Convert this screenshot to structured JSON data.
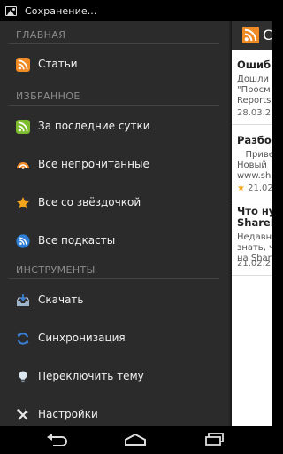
{
  "status_bar": {
    "icon": "image-icon",
    "text": "Сохранение..."
  },
  "action_bar": {
    "app_icon": "rss-app-icon",
    "title": "С"
  },
  "feed_items": [
    {
      "title": "Ошибк",
      "snippet": "Дошли\n\"Просм\nReports",
      "date": "28.03.2",
      "starred": false
    },
    {
      "title": "Разбор",
      "snippet": "   Приве\nНовый\nwww.sh",
      "date": "21.02",
      "starred": true
    },
    {
      "title": "Что ну\nShareP",
      "snippet": "Недавн\nзнать, ч\nна Shar",
      "date": "21.02.2",
      "starred": false
    }
  ],
  "drawer": {
    "sections": [
      {
        "label": "ГЛАВНАЯ",
        "items": [
          {
            "label": "Статьи",
            "icon": "rss-icon",
            "icon_color": "#f08a24"
          }
        ]
      },
      {
        "label": "ИЗБРАННОЕ",
        "items": [
          {
            "label": "За последние сутки",
            "icon": "rss-icon",
            "icon_color": "#7dbb2e"
          },
          {
            "label": "Все непрочитанные",
            "icon": "unread-icon",
            "icon_color": "#f08a24"
          },
          {
            "label": "Все со звёздочкой",
            "icon": "star-icon",
            "icon_color": "#f3a51c"
          },
          {
            "label": "Все подкасты",
            "icon": "rss-icon",
            "icon_color": "#2f7fd6"
          }
        ]
      },
      {
        "label": "ИНСТРУМЕНТЫ",
        "items": [
          {
            "label": "Скачать",
            "icon": "download-icon",
            "icon_color": "#5b8fd1"
          },
          {
            "label": "Синхронизация",
            "icon": "sync-icon",
            "icon_color": "#3a7fd3"
          },
          {
            "label": "Переключить тему",
            "icon": "lightbulb-icon",
            "icon_color": "#b9c9d8"
          },
          {
            "label": "Настройки",
            "icon": "tools-icon",
            "icon_color": "#e8e8e8"
          }
        ]
      }
    ]
  },
  "nav_bar": {
    "back_icon": "back-icon",
    "home_icon": "home-icon",
    "recents_icon": "recents-icon"
  }
}
